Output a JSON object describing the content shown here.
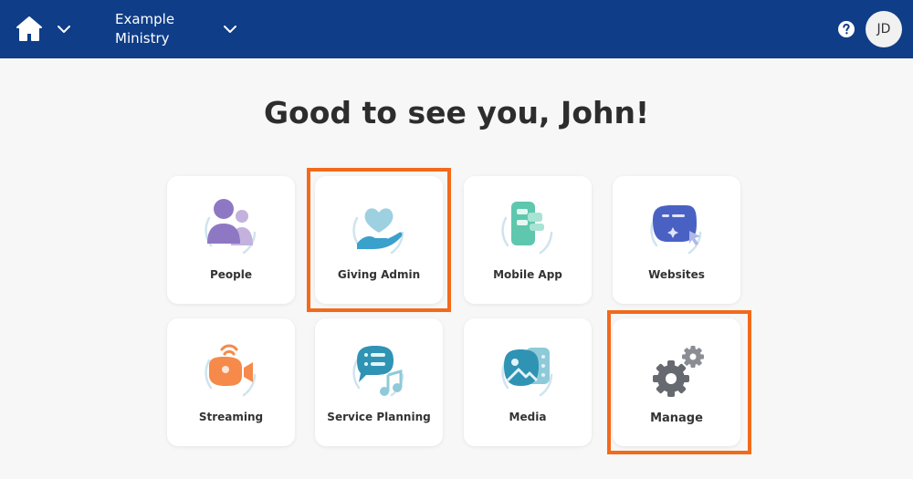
{
  "header": {
    "org_name": "Example Ministry",
    "avatar_initials": "JD",
    "background_color": "#0f3d87"
  },
  "greeting": "Good to see you, John!",
  "tiles": [
    {
      "label": "People",
      "icon": "people-icon"
    },
    {
      "label": "Giving Admin",
      "icon": "giving-hand-heart-icon"
    },
    {
      "label": "Mobile App",
      "icon": "mobile-app-icon"
    },
    {
      "label": "Websites",
      "icon": "website-browser-icon"
    },
    {
      "label": "Streaming",
      "icon": "video-camera-icon"
    },
    {
      "label": "Service Planning",
      "icon": "chat-music-note-icon"
    },
    {
      "label": "Media",
      "icon": "media-image-icon"
    },
    {
      "label": "Manage",
      "icon": "gears-icon"
    }
  ],
  "highlight_color": "#f26a1b"
}
